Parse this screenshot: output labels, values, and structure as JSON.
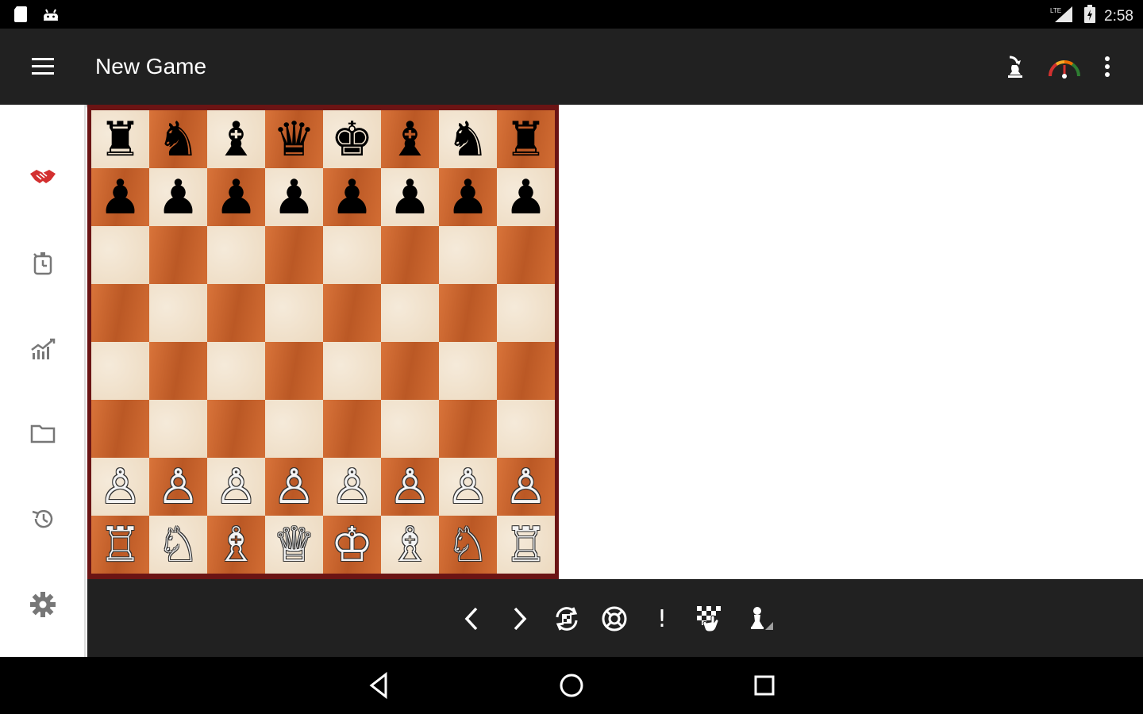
{
  "status_bar": {
    "time": "2:58",
    "network_label": "LTE"
  },
  "toolbar": {
    "title": "New Game"
  },
  "board": {
    "rows": [
      [
        "♜",
        "♞",
        "♝",
        "♛",
        "♚",
        "♝",
        "♞",
        "♜"
      ],
      [
        "♟",
        "♟",
        "♟",
        "♟",
        "♟",
        "♟",
        "♟",
        "♟"
      ],
      [
        "",
        "",
        "",
        "",
        "",
        "",
        "",
        ""
      ],
      [
        "",
        "",
        "",
        "",
        "",
        "",
        "",
        ""
      ],
      [
        "",
        "",
        "",
        "",
        "",
        "",
        "",
        ""
      ],
      [
        "",
        "",
        "",
        "",
        "",
        "",
        "",
        ""
      ],
      [
        "♙",
        "♙",
        "♙",
        "♙",
        "♙",
        "♙",
        "♙",
        "♙"
      ],
      [
        "♖",
        "♘",
        "♗",
        "♕",
        "♔",
        "♗",
        "♘",
        "♖"
      ]
    ],
    "light_color": "#f0dfc6",
    "dark_color": "#c9622b",
    "frame_color": "#6b1414"
  },
  "controls": {
    "prev": "‹",
    "next": "›",
    "exclaim": "!"
  },
  "colors": {
    "toolbar_bg": "#212121",
    "accent_red": "#d32f2f"
  }
}
